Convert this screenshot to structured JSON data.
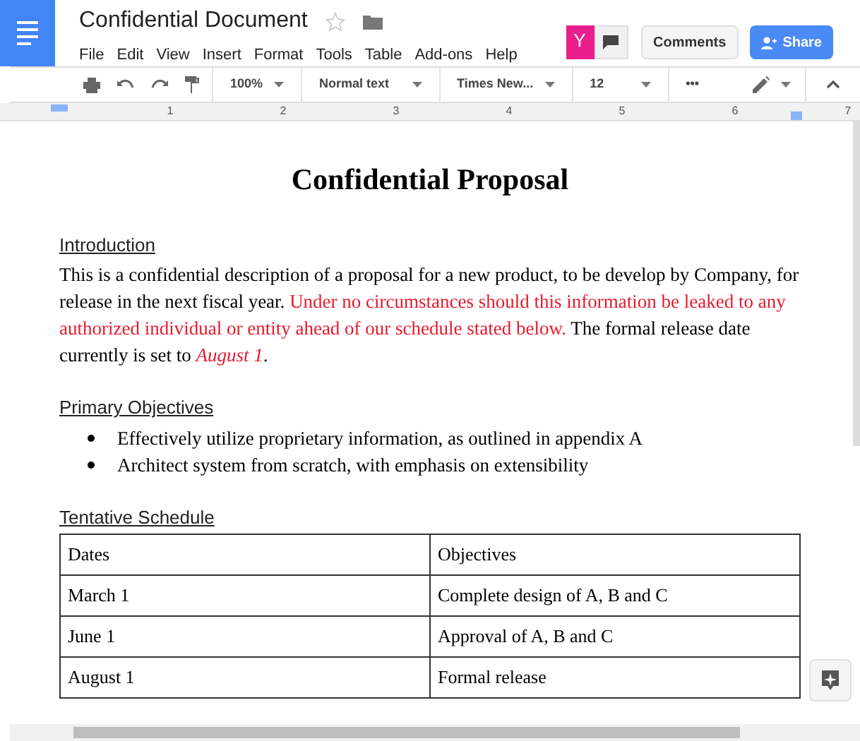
{
  "window": {
    "title": "Confidential Document",
    "starred": false
  },
  "menu": [
    "File",
    "Edit",
    "View",
    "Insert",
    "Format",
    "Tools",
    "Table",
    "Add-ons",
    "Help"
  ],
  "user_badge": "Y",
  "buttons": {
    "comments": "Comments",
    "share": "Share"
  },
  "toolbar": {
    "zoom": "100%",
    "style": "Normal text",
    "font": "Times New...",
    "size": "12",
    "more": "•••"
  },
  "ruler": [
    "1",
    "2",
    "3",
    "4",
    "5",
    "6",
    "7"
  ],
  "document": {
    "title": "Confidential Proposal",
    "sections": [
      {
        "heading": "Introduction",
        "kind": "paragraph",
        "segments": [
          {
            "text": "This is a confidential description of a proposal for a new product, to be develop by Company, for release in the next fiscal year. ",
            "kind": "plain"
          },
          {
            "text": "Under no circumstances should this information be leaked to any authorized individual or entity ahead of our schedule stated below.",
            "kind": "red"
          },
          {
            "text": " The formal release date currently is set to ",
            "kind": "plain"
          },
          {
            "text": "August 1",
            "kind": "red-italic"
          },
          {
            "text": ".",
            "kind": "plain"
          }
        ]
      },
      {
        "heading": "Primary Objectives",
        "kind": "bullets",
        "items": [
          "Effectively utilize proprietary information, as outlined in appendix A",
          "Architect system from scratch, with emphasis on extensibility"
        ]
      },
      {
        "heading": "Tentative Schedule",
        "kind": "table",
        "rows": [
          [
            "Dates",
            "Objectives"
          ],
          [
            "March 1",
            "Complete design of A, B and C"
          ],
          [
            "June 1",
            "Approval of A, B and C"
          ],
          [
            "August 1",
            "Formal release"
          ]
        ]
      }
    ]
  }
}
